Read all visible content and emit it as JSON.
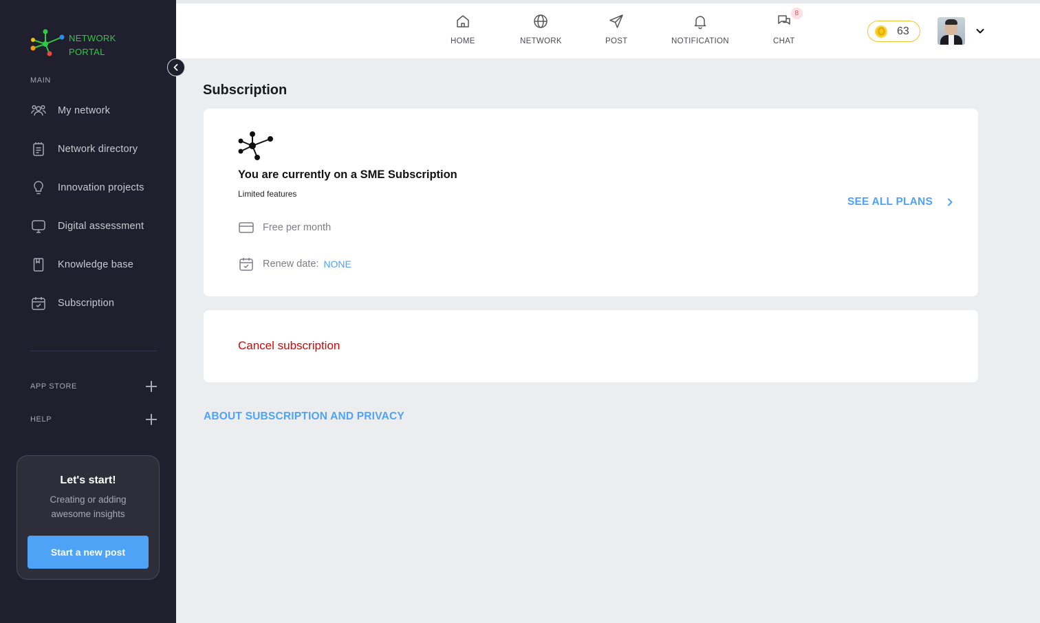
{
  "brand": {
    "line1": "NETWORK",
    "line2": "PORTAL"
  },
  "sidebar": {
    "main_label": "MAIN",
    "items": [
      {
        "label": "My network",
        "icon": "users-icon"
      },
      {
        "label": "Network directory",
        "icon": "directory-icon"
      },
      {
        "label": "Innovation projects",
        "icon": "lightbulb-icon"
      },
      {
        "label": "Digital assessment",
        "icon": "monitor-icon"
      },
      {
        "label": "Knowledge base",
        "icon": "book-icon"
      },
      {
        "label": "Subscription",
        "icon": "calendar-check-icon"
      }
    ],
    "app_store_label": "APP STORE",
    "help_label": "HELP",
    "start_card": {
      "title": "Let's start!",
      "line1": "Creating or adding",
      "line2": "awesome insights",
      "button": "Start a new post"
    }
  },
  "topnav": {
    "items": [
      {
        "label": "HOME",
        "icon": "home-icon"
      },
      {
        "label": "NETWORK",
        "icon": "globe-icon"
      },
      {
        "label": "POST",
        "icon": "send-icon"
      },
      {
        "label": "NOTIFICATION",
        "icon": "bell-icon"
      },
      {
        "label": "CHAT",
        "icon": "chat-icon"
      }
    ],
    "chat_badge": "8",
    "coins": "63"
  },
  "page": {
    "title": "Subscription",
    "current_plan": "You are currently on a SME Subscription",
    "plan_note": "Limited features",
    "price": "Free per month",
    "renew_label": "Renew date:",
    "renew_value": "NONE",
    "see_all": "SEE ALL PLANS",
    "cancel": "Cancel subscription",
    "about": "ABOUT SUBSCRIPTION AND PRIVACY"
  },
  "colors": {
    "sidebar_bg": "#1f1f2d",
    "accent_blue": "#4fa3f7",
    "danger_red": "#e00000",
    "brand_green": "#2ecc40"
  }
}
